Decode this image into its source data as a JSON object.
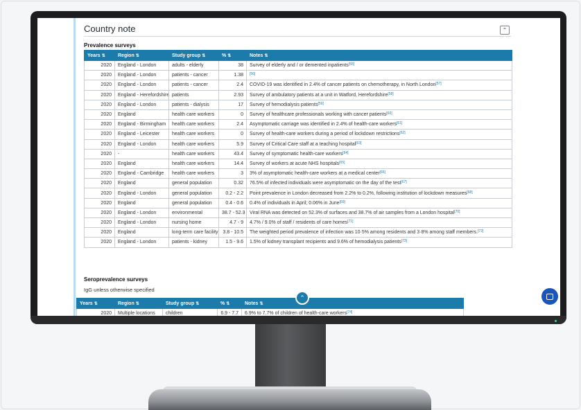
{
  "card": {
    "title": "Country note",
    "collapse_icon": "chevron-up-icon"
  },
  "prevalence": {
    "section_title": "Prevalence surveys",
    "headers": [
      "Years",
      "Region",
      "Study group",
      "%",
      "Notes"
    ],
    "rows": [
      {
        "year": "2020",
        "region": "England - London",
        "group": "adults - elderly",
        "pct": "38",
        "note": "Survey of elderly and / or demented inpatients",
        "ref": "[55]"
      },
      {
        "year": "2020",
        "region": "England - London",
        "group": "patients - cancer",
        "pct": "1.38",
        "note": "",
        "ref": "[56]"
      },
      {
        "year": "2020",
        "region": "England - London",
        "group": "patients - cancer",
        "pct": "2.4",
        "note": "COVID-19 was identified in 2.4% of cancer patients on chemotherapy, in North London",
        "ref": "[57]"
      },
      {
        "year": "2020",
        "region": "England - Herefordshire",
        "group": "patients",
        "pct": "2.93",
        "note": "Survey of ambulatory patients at a unit in Watford, Herefordshire",
        "ref": "[58]"
      },
      {
        "year": "2020",
        "region": "England - London",
        "group": "patients - dialysis",
        "pct": "17",
        "note": "Survey of hemodialysis patients",
        "ref": "[59]"
      },
      {
        "year": "2020",
        "region": "England",
        "group": "health care workers",
        "pct": "0",
        "note": "Survey of healthcare professionals working with cancer patients",
        "ref": "[60]"
      },
      {
        "year": "2020",
        "region": "England - Birmingham",
        "group": "health care workers",
        "pct": "2.4",
        "note": "Asymptomatic carriage was identified in 2.4% of health-care workers",
        "ref": "[61]"
      },
      {
        "year": "2020",
        "region": "England - Leicester",
        "group": "health care workers",
        "pct": "0",
        "note": "Survey of health-care workers during a period of lockdown restrictions",
        "ref": "[62]"
      },
      {
        "year": "2020",
        "region": "England - London",
        "group": "health care workers",
        "pct": "5.9",
        "note": "Survey of Critical Care staff at a teaching hospital",
        "ref": "[63]"
      },
      {
        "year": "2020",
        "region": "-",
        "group": "health care workers",
        "pct": "43.4",
        "note": "Survey of symptomatic health-care workers",
        "ref": "[64]"
      },
      {
        "year": "2020",
        "region": "England",
        "group": "health care workers",
        "pct": "14.4",
        "note": "Survey of workers at acute NHS hospitals",
        "ref": "[65]"
      },
      {
        "year": "2020",
        "region": "England - Cambridge",
        "group": "health care workers",
        "pct": "3",
        "note": "3% of asymptomatic health-care workers at a medical center",
        "ref": "[66]"
      },
      {
        "year": "2020",
        "region": "England",
        "group": "general population",
        "pct": "0.32",
        "note": "76.5% of infected individuals were asymptomatic on the day of the test",
        "ref": "[67]"
      },
      {
        "year": "2020",
        "region": "England - London",
        "group": "general population",
        "pct": "0.2 - 2.2",
        "note": "Point prevalence in London decreased from 2.2% to 0.2%, following institution of lockdown measures",
        "ref": "[68]"
      },
      {
        "year": "2020",
        "region": "England",
        "group": "general population",
        "pct": "0.4 - 0.6",
        "note": "0.4% of individuals in April; 0.06% in June",
        "ref": "[69]"
      },
      {
        "year": "2020",
        "region": "England - London",
        "group": "environmental",
        "pct": "38.7 - 52.3",
        "note": "Viral RNA was detected on 52.3% of surfaces and 38.7% of air samples from a London hospital",
        "ref": "[70]"
      },
      {
        "year": "2020",
        "region": "England - London",
        "group": "nursing home",
        "pct": "4.7 - 9",
        "note": "4.7% / 9.0% of staff / residents of care homes",
        "ref": "[71]"
      },
      {
        "year": "2020",
        "region": "England",
        "group": "long-term care facility",
        "pct": "3.8 - 10.5",
        "note": "The weighted period prevalence of infection was 10·5% among residents and 3·8% among staff members.",
        "ref": "[72]"
      },
      {
        "year": "2020",
        "region": "England - London",
        "group": "patients - kidney",
        "pct": "1.5 - 9.6",
        "note": "1.5% of kidney transplant recipients and 9.6% of hemodialysis patients",
        "ref": "[73]"
      }
    ]
  },
  "seroprevalence": {
    "section_title": "Seroprevalence surveys",
    "subtitle": "IgG unless otherwise specified",
    "headers": [
      "Years",
      "Region",
      "Study group",
      "%",
      "Notes"
    ],
    "rows": [
      {
        "year": "2020",
        "region": "Multiple locations",
        "group": "children",
        "pct": "6.9 - 7.7",
        "note": "6.9% to 7.7% of children of health-care workers",
        "ref": "[74]"
      }
    ]
  },
  "icons": {
    "sort": "sort-icon",
    "scroll_up": "chevron-up-icon",
    "chat": "chat-icon"
  }
}
